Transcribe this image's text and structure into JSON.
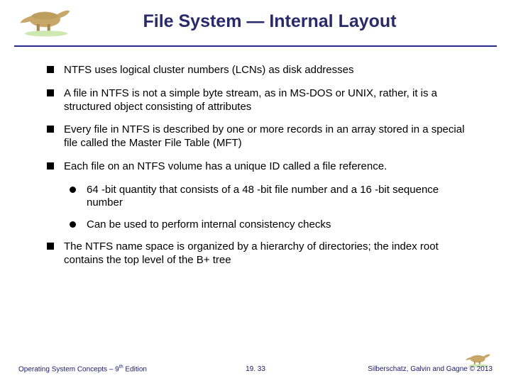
{
  "title": "File System — Internal Layout",
  "bullets": {
    "b0": "NTFS uses logical cluster numbers (LCNs) as disk addresses",
    "b1": "A file in NTFS is not a simple byte stream, as in MS-DOS or UNIX, rather, it is a structured object consisting of attributes",
    "b2": "Every file in NTFS is described by one or more records in an array stored in a special file called the Master File Table (MFT)",
    "b3": "Each file on an NTFS volume has a unique ID called a file reference.",
    "b3s0": "64 -bit quantity that consists of a 48 -bit file number and a 16 -bit sequence number",
    "b3s1": "Can be used to perform internal consistency checks",
    "b4": "The NTFS name space is organized by a hierarchy of directories; the index root contains the top level of the B+ tree"
  },
  "footer": {
    "left_pre": "Operating System Concepts – 9",
    "left_sup": "th",
    "left_post": " Edition",
    "center": "19. 33",
    "right": "Silberschatz, Galvin and Gagne © 2013"
  }
}
